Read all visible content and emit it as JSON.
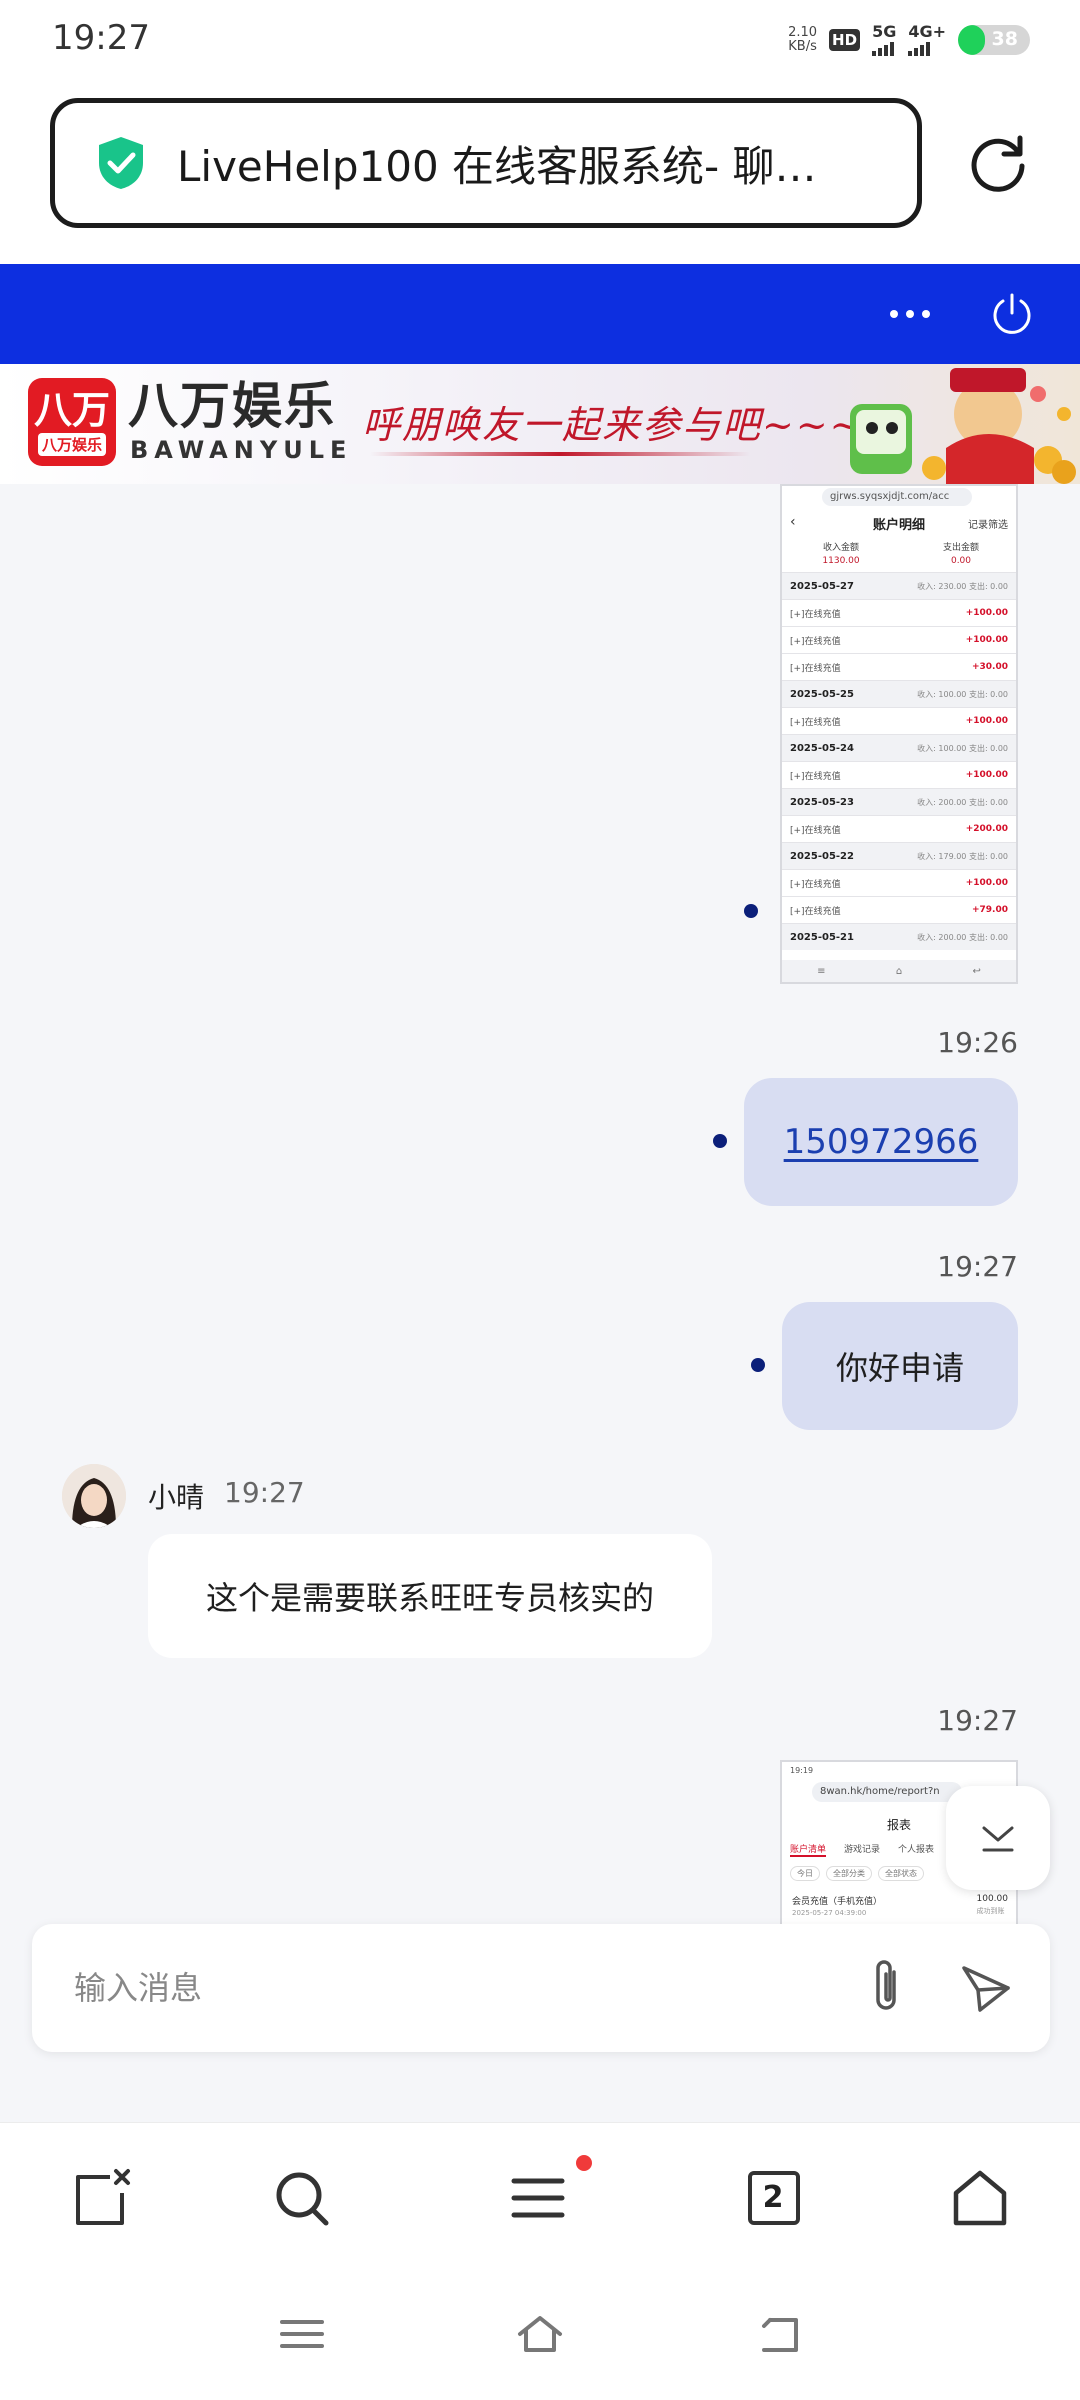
{
  "status_bar": {
    "time": "19:27",
    "net_speed_value": "2.10",
    "net_speed_unit": "KB/s",
    "hd_label": "HD",
    "sim1_label": "5G",
    "sim2_label": "4G+",
    "battery": "38",
    "battery_level": 0.38
  },
  "browser": {
    "page_title": "LiveHelp100 在线客服系统- 聊…"
  },
  "banner": {
    "logo_big": "八万",
    "logo_small": "八万娱乐",
    "brand_cn": "八万娱乐",
    "brand_en": "BAWANYULE",
    "slogan": "呼朋唤友一起来参与吧~~~"
  },
  "chat": {
    "screenshot1": {
      "url": "gjrws.syqsxjdjt.com/acc",
      "title": "账户明细",
      "filter": "记录筛选",
      "income_label": "收入金额",
      "income_value": "1130.00",
      "expense_label": "支出金额",
      "expense_value": "0.00",
      "rows": [
        {
          "type": "date",
          "label": "2025-05-27",
          "meta": "收入: 230.00  支出: 0.00"
        },
        {
          "type": "item",
          "label": "[+]在线充值",
          "amount": "+100.00"
        },
        {
          "type": "item",
          "label": "[+]在线充值",
          "amount": "+100.00"
        },
        {
          "type": "item",
          "label": "[+]在线充值",
          "amount": "+30.00"
        },
        {
          "type": "date",
          "label": "2025-05-25",
          "meta": "收入: 100.00  支出: 0.00"
        },
        {
          "type": "item",
          "label": "[+]在线充值",
          "amount": "+100.00"
        },
        {
          "type": "date",
          "label": "2025-05-24",
          "meta": "收入: 100.00  支出: 0.00"
        },
        {
          "type": "item",
          "label": "[+]在线充值",
          "amount": "+100.00"
        },
        {
          "type": "date",
          "label": "2025-05-23",
          "meta": "收入: 200.00  支出: 0.00"
        },
        {
          "type": "item",
          "label": "[+]在线充值",
          "amount": "+200.00"
        },
        {
          "type": "date",
          "label": "2025-05-22",
          "meta": "收入: 179.00  支出: 0.00"
        },
        {
          "type": "item",
          "label": "[+]在线充值",
          "amount": "+100.00"
        },
        {
          "type": "item",
          "label": "[+]在线充值",
          "amount": "+79.00"
        },
        {
          "type": "date",
          "label": "2025-05-21",
          "meta": "收入: 200.00  支出: 0.00"
        }
      ]
    },
    "time_1": "19:26",
    "msg_1": "150972966",
    "time_2": "19:27",
    "msg_2": "你好申请",
    "agent_name": "小晴",
    "agent_time": "19:27",
    "agent_msg": "这个是需要联系旺旺专员核实的",
    "time_3": "19:27",
    "screenshot2": {
      "status_time": "19:19",
      "url": "8wan.hk/home/report?n",
      "title": "报表",
      "tabs": [
        "账户清单",
        "游戏记录",
        "个人报表"
      ],
      "filters": [
        "今日",
        "全部分类",
        "全部状态"
      ],
      "item_name": "会员充值（手机充值）",
      "item_time": "2025-05-27 04:39:00",
      "item_amount": "100.00",
      "item_status": "成功到账"
    }
  },
  "input": {
    "placeholder": "输入消息"
  },
  "toolbar": {
    "tab_count": "2"
  }
}
